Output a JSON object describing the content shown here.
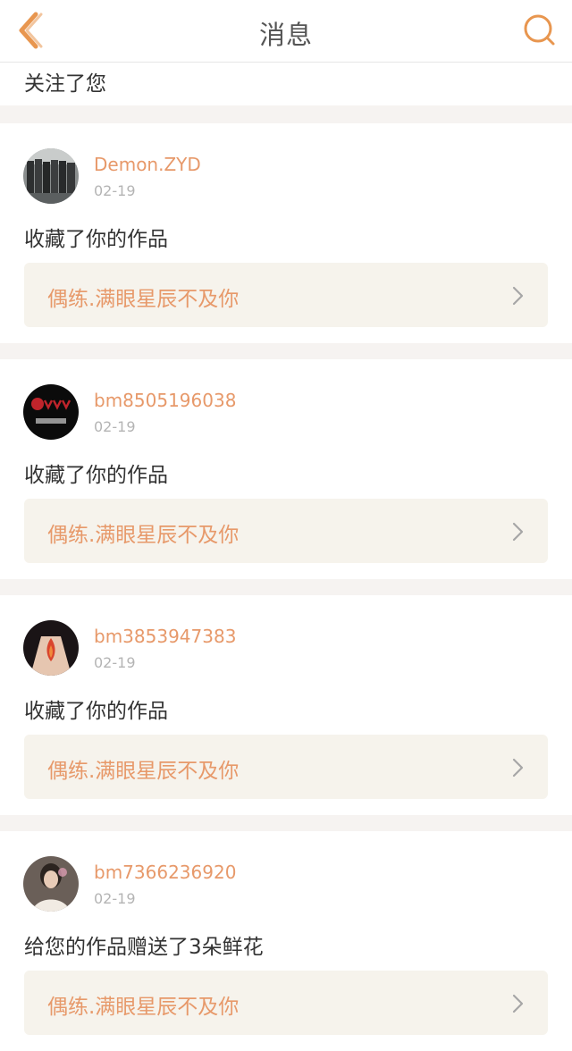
{
  "header": {
    "title": "消息",
    "back_icon": "chevron-left-icon",
    "search_icon": "search-icon",
    "accent_color": "#e8964f"
  },
  "previous_item": {
    "action": "关注了您"
  },
  "messages": [
    {
      "user": "Demon.ZYD",
      "date": "02-19",
      "action": "收藏了你的作品",
      "work_title": "偶练.满眼星辰不及你"
    },
    {
      "user": "bm8505196038",
      "date": "02-19",
      "action": "收藏了你的作品",
      "work_title": "偶练.满眼星辰不及你"
    },
    {
      "user": "bm3853947383",
      "date": "02-19",
      "action": "收藏了你的作品",
      "work_title": "偶练.满眼星辰不及你"
    },
    {
      "user": "bm7366236920",
      "date": "02-19",
      "action": "给您的作品赠送了3朵鲜花",
      "work_title": "偶练.满眼星辰不及你"
    }
  ],
  "colors": {
    "username": "#e7996a",
    "date": "#b4b4b4",
    "card_link_bg": "#f6f3ec",
    "divider": "#f6f3f1"
  }
}
